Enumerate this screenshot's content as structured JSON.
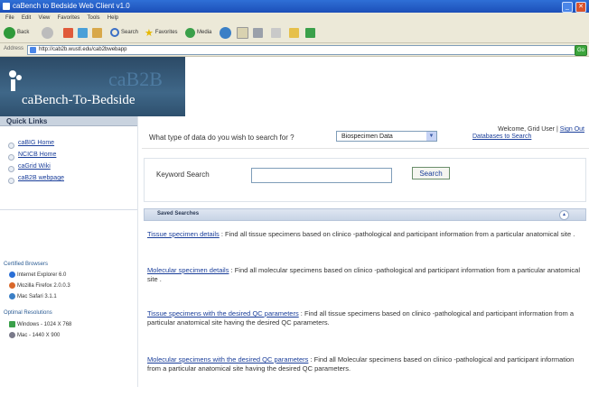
{
  "window": {
    "title": "caBench to Bedside Web Client v1.0",
    "minimize_glyph": "_",
    "close_glyph": "✕"
  },
  "menubar": [
    "File",
    "Edit",
    "View",
    "Favorites",
    "Tools",
    "Help"
  ],
  "toolbar": {
    "back": "Back",
    "search": "Search",
    "favorites": "Favorites",
    "media": "Media"
  },
  "address": {
    "label": "Address",
    "url": "http://cab2b.wustl.edu/cab2bwebapp",
    "go": "Go"
  },
  "header": {
    "logo_text": "caBench-To-Bedside",
    "logo_ghost": "caB2B",
    "welcome": "Welcome, Grid User",
    "divider": "|",
    "sign_out": "Sign Out"
  },
  "quick_links": {
    "title": "Quick Links",
    "items": [
      "caBIG Home",
      "NCICB Home",
      "caGrid Wiki",
      "caB2B webpage"
    ]
  },
  "sidebar": {
    "browsers_title": "Certified Browsers",
    "browsers": [
      "Internet Explorer 6.0",
      "Mozilla Firefox 2.0.0.3",
      "Mac Safari 3.1.1"
    ],
    "resolutions_title": "Optimal Resolutions",
    "resolutions": [
      "Windows - 1024 X 768",
      "Mac - 1440 X 900"
    ],
    "colors": {
      "ie": "#2a6fd6",
      "firefox": "#d9682a",
      "safari": "#3a7fc6",
      "windows": "#3aa04a",
      "mac": "#7a7a8a"
    }
  },
  "main": {
    "question": "What type of data do you wish to search for ?",
    "data_type": "Biospecimen Data",
    "databases_link": "Databases to Search",
    "keyword_label": "Keyword Search",
    "keyword_value": "",
    "search_button": "Search",
    "saved_title": "Saved Searches",
    "saved": [
      {
        "title": "Tissue specimen details",
        "desc": " : Find all tissue specimens based on clinico -pathological and participant information from a particular anatomical site ."
      },
      {
        "title": "Molecular specimen details",
        "desc": " : Find all molecular specimens based on clinico -pathological and participant information from a particular anatomical site ."
      },
      {
        "title": "Tissue specimens with the desired QC parameters",
        "desc": " : Find all tissue specimens based on clinico -pathological and participant information from a particular anatomical site having the desired QC parameters."
      },
      {
        "title": "Molecular specimens with the desired QC parameters",
        "desc": " : Find all Molecular specimens based on clinico -pathological and participant information from a particular anatomical site having the desired QC parameters."
      }
    ]
  }
}
